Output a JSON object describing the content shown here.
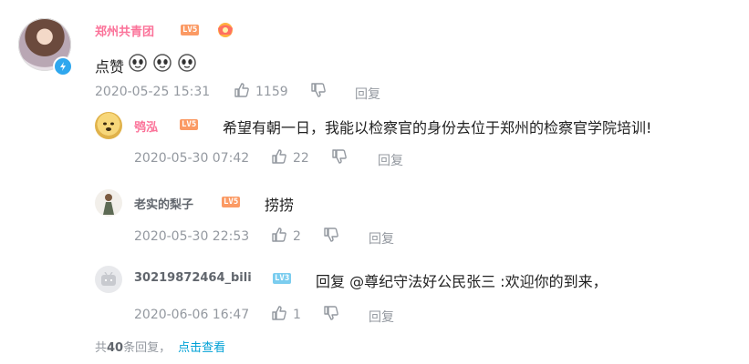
{
  "comment": {
    "username": "郑州共青团",
    "level": "LV5",
    "text": "点赞",
    "emoji_count": 3,
    "timestamp": "2020-05-25 15:31",
    "likes": "1159",
    "reply_label": "回复"
  },
  "replies": [
    {
      "username": "鸮泓",
      "level": "LV5",
      "text": "希望有朝一日，我能以检察官的身份去位于郑州的检察官学院培训!",
      "timestamp": "2020-05-30 07:42",
      "likes": "22",
      "reply_label": "回复"
    },
    {
      "username": "老实的梨子",
      "level": "LV5",
      "text": "捞捞",
      "timestamp": "2020-05-30 22:53",
      "likes": "2",
      "reply_label": "回复"
    },
    {
      "username": "30219872464_bili",
      "level": "LV3",
      "text": "回复 @尊纪守法好公民张三 :欢迎你的到来，",
      "timestamp": "2020-06-06 16:47",
      "likes": "1",
      "reply_label": "回复"
    }
  ],
  "footer": {
    "prefix": "共",
    "count": "40",
    "suffix": "条回复，",
    "view_link": "点击查看"
  },
  "colors": {
    "username_vip": "#fb7299",
    "meta": "#9499a0",
    "link": "#00a1d6",
    "lv5": "#fb9a64",
    "lv3": "#7bcdef"
  }
}
